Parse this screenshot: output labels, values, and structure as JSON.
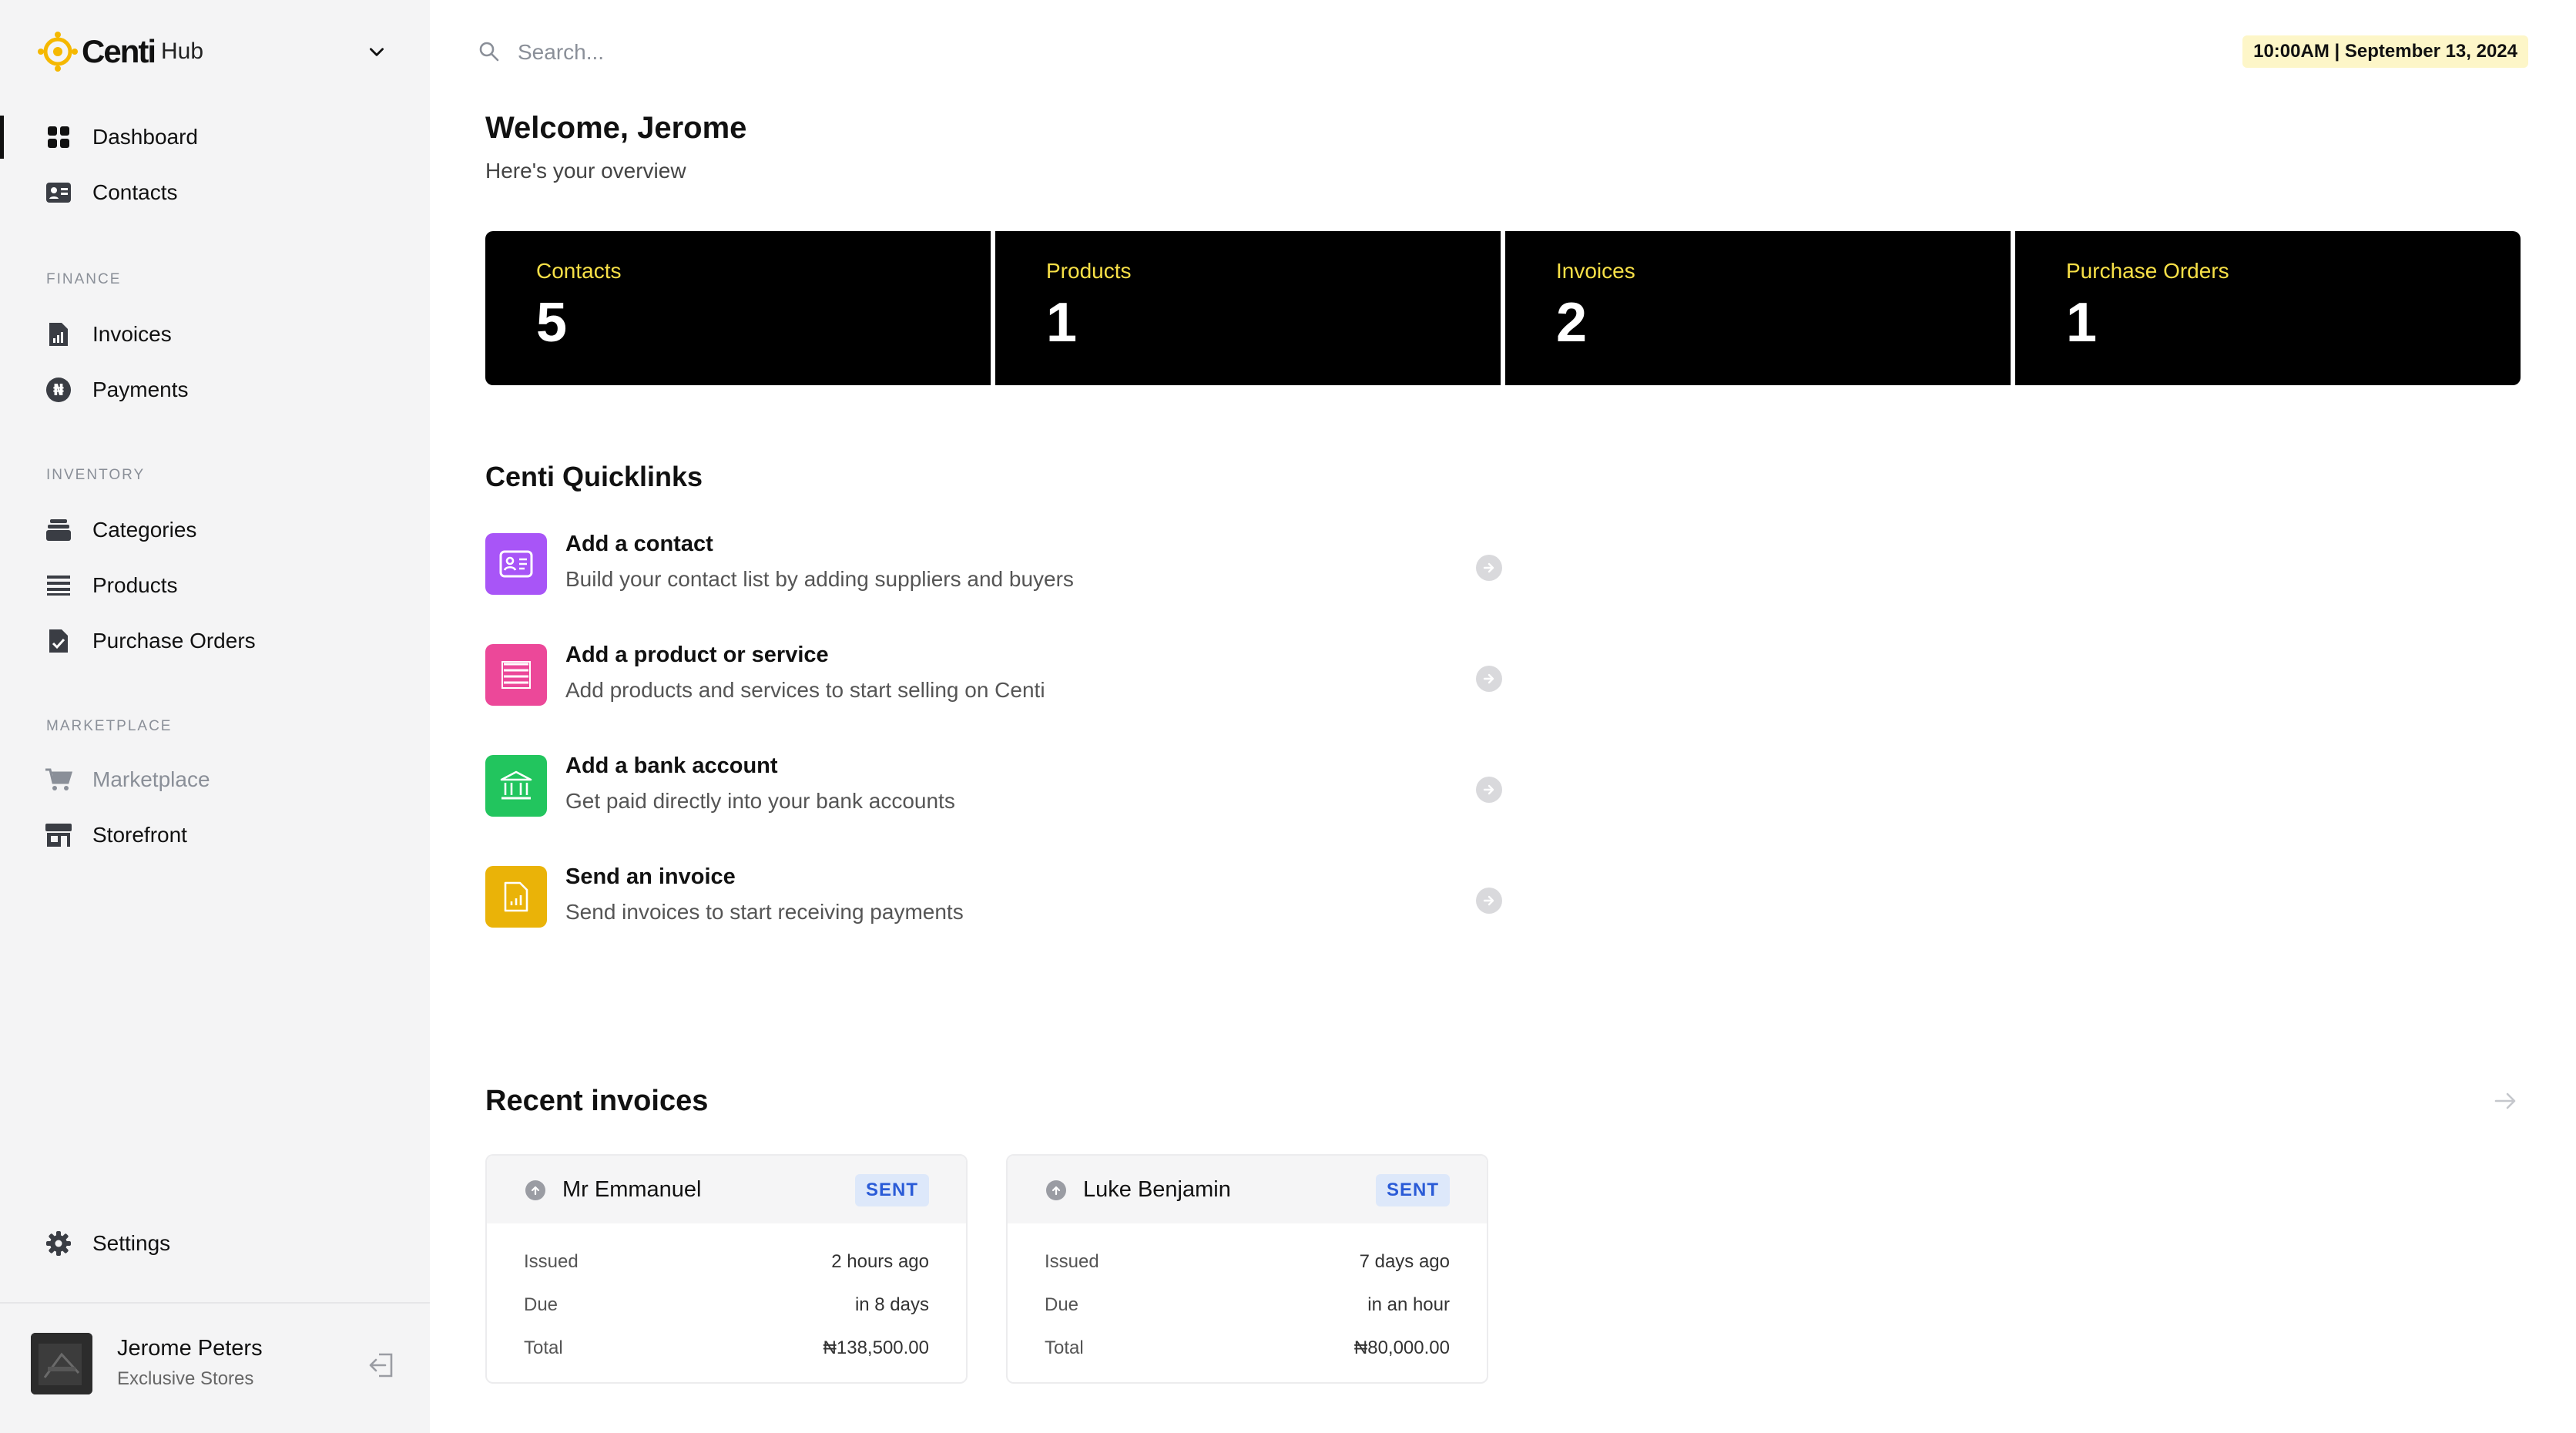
{
  "brand": {
    "name": "Centi",
    "suffix": "Hub"
  },
  "sidebar": {
    "top": [
      {
        "label": "Dashboard"
      },
      {
        "label": "Contacts"
      }
    ],
    "sections": [
      {
        "title": "FINANCE",
        "items": [
          {
            "label": "Invoices"
          },
          {
            "label": "Payments"
          }
        ]
      },
      {
        "title": "INVENTORY",
        "items": [
          {
            "label": "Categories"
          },
          {
            "label": "Products"
          },
          {
            "label": "Purchase Orders"
          }
        ]
      },
      {
        "title": "MARKETPLACE",
        "items": [
          {
            "label": "Marketplace"
          },
          {
            "label": "Storefront"
          }
        ]
      }
    ],
    "settings": "Settings",
    "user": {
      "name": "Jerome Peters",
      "store": "Exclusive Stores"
    }
  },
  "search": {
    "placeholder": "Search..."
  },
  "datetime": "10:00AM | September 13, 2024",
  "welcome": "Welcome,  Jerome",
  "overview": "Here's your overview",
  "stats": [
    {
      "label": "Contacts",
      "value": "5"
    },
    {
      "label": "Products",
      "value": "1"
    },
    {
      "label": "Invoices",
      "value": "2"
    },
    {
      "label": "Purchase Orders",
      "value": "1"
    }
  ],
  "quicklinks": {
    "title": "Centi Quicklinks",
    "items": [
      {
        "title": "Add a contact",
        "subtitle": "Build your contact list by adding suppliers and buyers",
        "color": "#a855f7",
        "icon": "contact-card-icon"
      },
      {
        "title": "Add a product or service",
        "subtitle": "Add products and services to start selling on Centi",
        "color": "#ec4899",
        "icon": "list-icon"
      },
      {
        "title": "Add a bank account",
        "subtitle": "Get paid directly into your bank accounts",
        "color": "#22c55e",
        "icon": "bank-icon"
      },
      {
        "title": "Send an invoice",
        "subtitle": "Send invoices to start receiving payments",
        "color": "#eab308",
        "icon": "invoice-icon"
      }
    ]
  },
  "recent_invoices": {
    "title": "Recent invoices",
    "labels": {
      "issued": "Issued",
      "due": "Due",
      "total": "Total"
    },
    "items": [
      {
        "name": "Mr Emmanuel",
        "status": "SENT",
        "issued": "2 hours ago",
        "due": "in 8 days",
        "total": "₦138,500.00"
      },
      {
        "name": "Luke Benjamin",
        "status": "SENT",
        "issued": "7 days ago",
        "due": "in an hour",
        "total": "₦80,000.00"
      }
    ]
  },
  "colors": {
    "stat_label": "#f7e047",
    "badge_bg": "#dde8fa",
    "badge_text": "#2a5bd7",
    "date_bg": "#fdf6c8"
  }
}
